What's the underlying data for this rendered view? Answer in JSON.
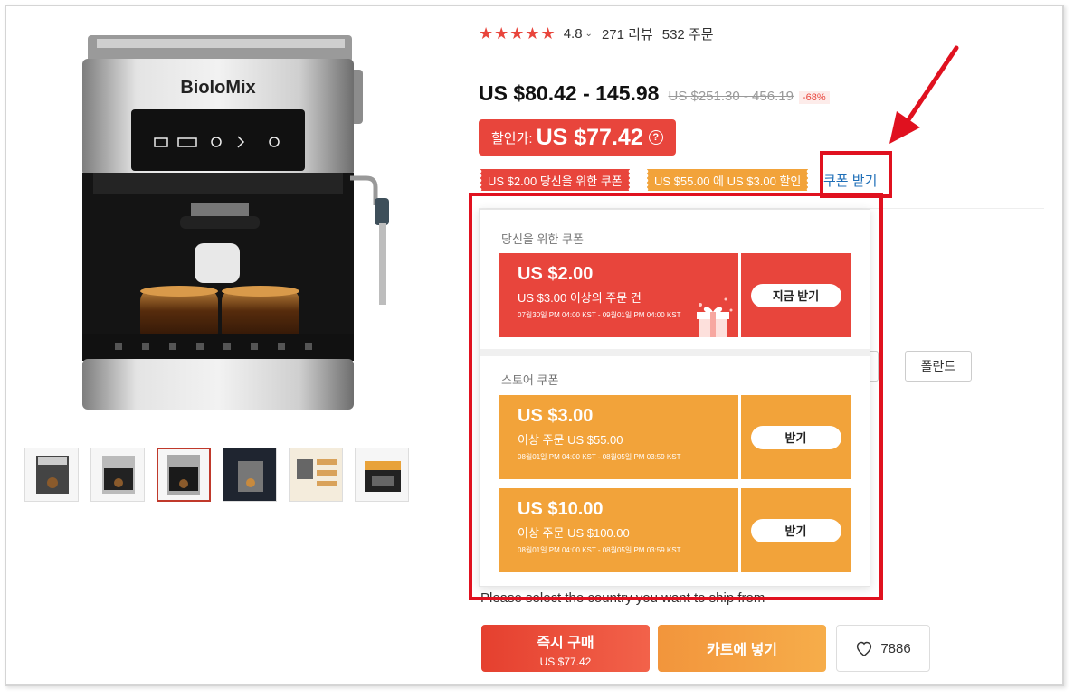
{
  "product": {
    "brand": "BioloMix",
    "rating": "4.8",
    "reviews": "271 리뷰",
    "orders": "532 주문",
    "price_range": "US $80.42 - 145.98",
    "original_price": "US $251.30 - 456.19",
    "discount": "-68%",
    "sale_label": "할인가:",
    "sale_price": "US $77.42",
    "help_icon": "?"
  },
  "tags": {
    "personal": "US $2.00 당신을 위한 쿠폰",
    "store": "US $55.00 에 US $3.00 할인",
    "get_coupon_link": "쿠폰 받기"
  },
  "popup": {
    "personal_title": "당신을 위한 쿠폰",
    "store_title": "스토어 쿠폰",
    "personal_coupons": [
      {
        "amount": "US $2.00",
        "condition": "US $3.00 이상의 주문 건",
        "dates": "07월30일 PM 04:00 KST - 09월01일 PM 04:00 KST",
        "button": "지금 받기"
      }
    ],
    "store_coupons": [
      {
        "amount": "US $3.00",
        "condition": "이상 주문 US $55.00",
        "dates": "08월01일 PM 04:00 KST - 08월05일 PM 03:59 KST",
        "button": "받기"
      },
      {
        "amount": "US $10.00",
        "condition": "이상 주문 US $100.00",
        "dates": "08월01일 PM 04:00 KST - 08월05일 PM 03:59 KST",
        "button": "받기"
      }
    ]
  },
  "shipping": {
    "country_button": "폴란드",
    "prompt": "Please select the country you want to ship from"
  },
  "actions": {
    "buy_now": "즉시 구매",
    "buy_now_price": "US $77.42",
    "add_to_cart": "카트에 넣기",
    "wishlist_count": "7886"
  },
  "colors": {
    "accent_red": "#e8453c",
    "accent_orange": "#f2a33a",
    "annotation_red": "#e0111f",
    "link_blue": "#1f6fb8"
  },
  "icons": [
    "star-icon",
    "chevron-down-icon",
    "question-icon",
    "heart-icon",
    "gift-icon",
    "arrow-annotation"
  ]
}
